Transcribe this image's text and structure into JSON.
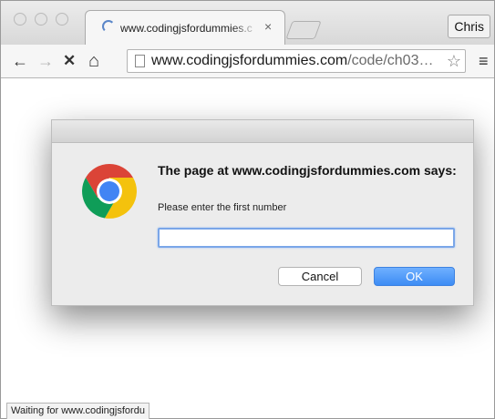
{
  "tab": {
    "title": "www.codingjsfordummies.c",
    "close_glyph": "×",
    "loading": true
  },
  "profile": {
    "name": "Chris"
  },
  "toolbar": {
    "back_glyph": "←",
    "forward_glyph": "→",
    "stop_glyph": "✕",
    "home_glyph": "⌂",
    "url_host": "www.codingjsfordummies.com",
    "url_path": "/code/ch03…",
    "star_glyph": "☆",
    "menu_glyph": "≡"
  },
  "dialog": {
    "heading": "The page at www.codingjsfordummies.com says:",
    "message": "Please enter the first number",
    "input_value": "",
    "cancel_label": "Cancel",
    "ok_label": "OK"
  },
  "status": {
    "text": "Waiting for www.codingjsfordu"
  },
  "colors": {
    "accent": "#3d8cf4",
    "input_focus": "#7aa6e8"
  },
  "icons": [
    "spinner-icon",
    "close-icon",
    "back-icon",
    "forward-icon",
    "stop-icon",
    "home-icon",
    "page-icon",
    "star-icon",
    "menu-icon",
    "chrome-logo-icon"
  ]
}
